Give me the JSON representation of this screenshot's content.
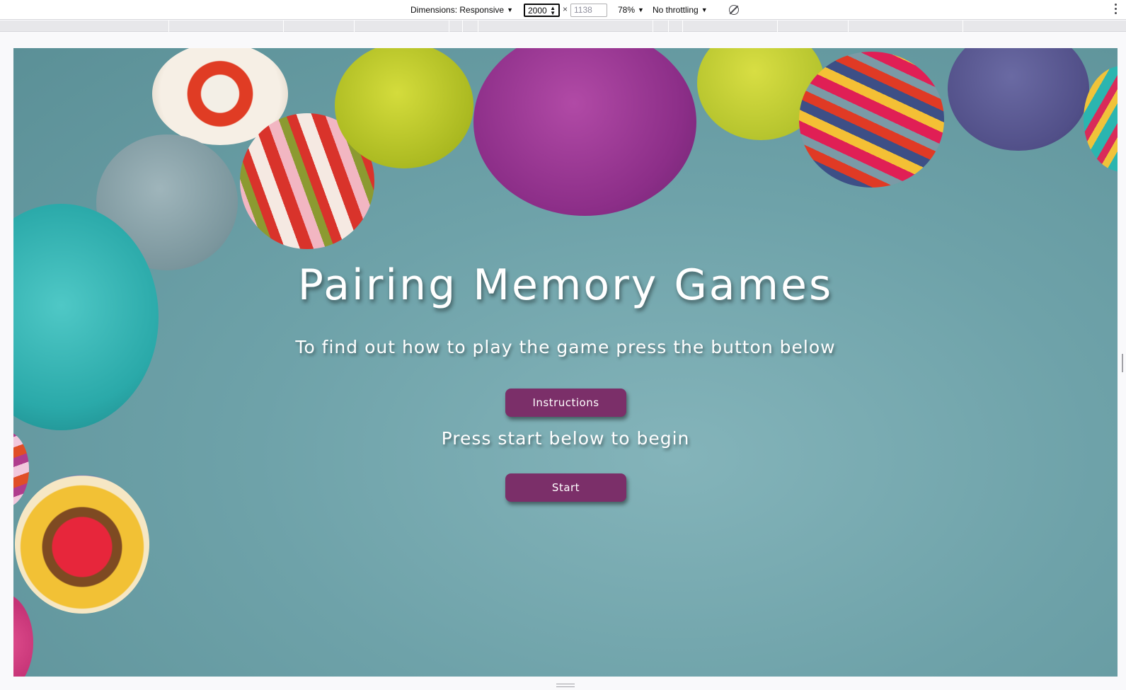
{
  "devtools": {
    "dimensions_label": "Dimensions: Responsive",
    "width_value": "2000",
    "height_placeholder": "1138",
    "times": "×",
    "zoom": "78%",
    "throttling": "No throttling",
    "caret": "▼"
  },
  "page": {
    "title": "Pairing Memory Games",
    "subtitle": "To find out how to play the game press the button below",
    "instructions_button": "Instructions",
    "press_start_text": "Press start below to begin",
    "start_button": "Start"
  },
  "colors": {
    "button_bg": "#7b2f69",
    "text": "#ffffff",
    "background": "#6ea2a9"
  }
}
